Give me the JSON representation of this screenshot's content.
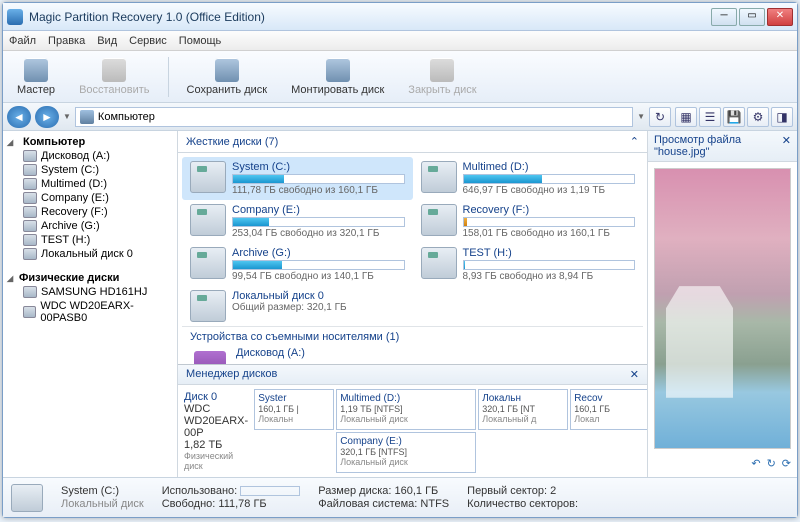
{
  "window": {
    "title": "Magic Partition Recovery 1.0 (Office Edition)"
  },
  "menu": {
    "file": "Файл",
    "edit": "Правка",
    "view": "Вид",
    "service": "Сервис",
    "help": "Помощь"
  },
  "toolbar": {
    "wizard": "Мастер",
    "restore": "Восстановить",
    "savedisk": "Сохранить диск",
    "mount": "Монтировать диск",
    "close": "Закрыть диск"
  },
  "nav": {
    "location": "Компьютер"
  },
  "tree": {
    "computer": "Компьютер",
    "items": [
      {
        "label": "Дисковод (A:)"
      },
      {
        "label": "System (C:)"
      },
      {
        "label": "Multimed (D:)"
      },
      {
        "label": "Company (E:)"
      },
      {
        "label": "Recovery (F:)"
      },
      {
        "label": "Archive (G:)"
      },
      {
        "label": "TEST (H:)"
      },
      {
        "label": "Локальный диск 0"
      }
    ],
    "physical_header": "Физические диски",
    "physical": [
      {
        "label": "SAMSUNG HD161HJ"
      },
      {
        "label": "WDC WD20EARX-00PASB0"
      }
    ]
  },
  "groups": {
    "hard": "Жесткие диски (7)",
    "removable": "Устройства со съемными носителями (1)",
    "mgr": "Менеджер дисков"
  },
  "disks": {
    "system": {
      "name": "System (C:)",
      "free": "111,78 ГБ свободно из 160,1 ГБ",
      "pct": 30,
      "color": ""
    },
    "multimed": {
      "name": "Multimed (D:)",
      "free": "646,97 ГБ свободно из 1,19 ТБ",
      "pct": 46,
      "color": ""
    },
    "company": {
      "name": "Company (E:)",
      "free": "253,04 ГБ свободно из 320,1 ГБ",
      "pct": 21,
      "color": ""
    },
    "recovery": {
      "name": "Recovery (F:)",
      "free": "158,01 ГБ свободно из 160,1 ГБ",
      "pct": 2,
      "color": "orange"
    },
    "archive": {
      "name": "Archive (G:)",
      "free": "99,54 ГБ свободно из 140,1 ГБ",
      "pct": 29,
      "color": ""
    },
    "test": {
      "name": "TEST (H:)",
      "free": "8,93 ГБ свободно из 8,94 ГБ",
      "pct": 1,
      "color": ""
    },
    "local0": {
      "name": "Локальный диск 0",
      "free": "Общий размер: 320,1 ГБ",
      "pct": 0,
      "color": ""
    },
    "floppy": {
      "name": "Дисковод (A:)"
    }
  },
  "diskmgr": {
    "phys": {
      "title": "Диск 0",
      "model": "WDC WD20EARX-00P",
      "size": "1,82 ТБ",
      "type": "Физический диск"
    },
    "cells": [
      {
        "name": "Syster",
        "size": "160,1 ГБ |",
        "type": "Локальн"
      },
      {
        "name": "Multimed (D:)",
        "size": "1,19 ТБ [NTFS]",
        "type": "Локальный диск"
      },
      {
        "name": "Локальн",
        "size": "320,1 ГБ [NT",
        "type": "Локальный д"
      },
      {
        "name": "Recov",
        "size": "160,1 ГБ",
        "type": "Локал"
      },
      {
        "name": "Company (E:)",
        "size": "320,1 ГБ [NTFS]",
        "type": "Локальный диск"
      }
    ]
  },
  "preview": {
    "title": "Просмотр файла \"house.jpg\""
  },
  "status": {
    "selname": "System (C:)",
    "seltype": "Локальный диск",
    "used_label": "Использовано:",
    "free_label": "Свободно:",
    "free_val": "111,78 ГБ",
    "size_label": "Размер диска:",
    "size_val": "160,1 ГБ",
    "fs_label": "Файловая система:",
    "fs_val": "NTFS",
    "sector_label": "Первый сектор:",
    "sector_val": "2",
    "count_label": "Количество секторов:"
  }
}
